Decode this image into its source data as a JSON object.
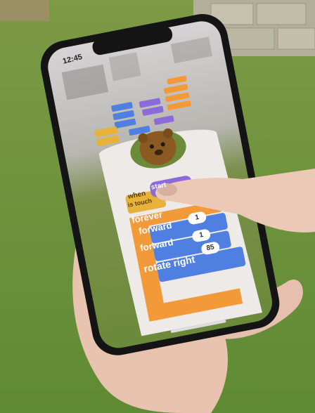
{
  "status_bar": {
    "time": "12:45"
  },
  "event_block": {
    "line1": "when",
    "line2": "is touch",
    "tag": "start"
  },
  "code_blocks": {
    "loop": "forever",
    "steps": [
      {
        "label": "forward",
        "value": "1"
      },
      {
        "label": "forward",
        "value": "1"
      },
      {
        "label": "rotate right",
        "value": "85"
      }
    ]
  },
  "colors": {
    "control_block": "#f29a3a",
    "motion_block": "#4f7fe0",
    "event_block": "#e6b23a",
    "tag_block": "#8b6ad9",
    "phone_frame": "#141414"
  }
}
